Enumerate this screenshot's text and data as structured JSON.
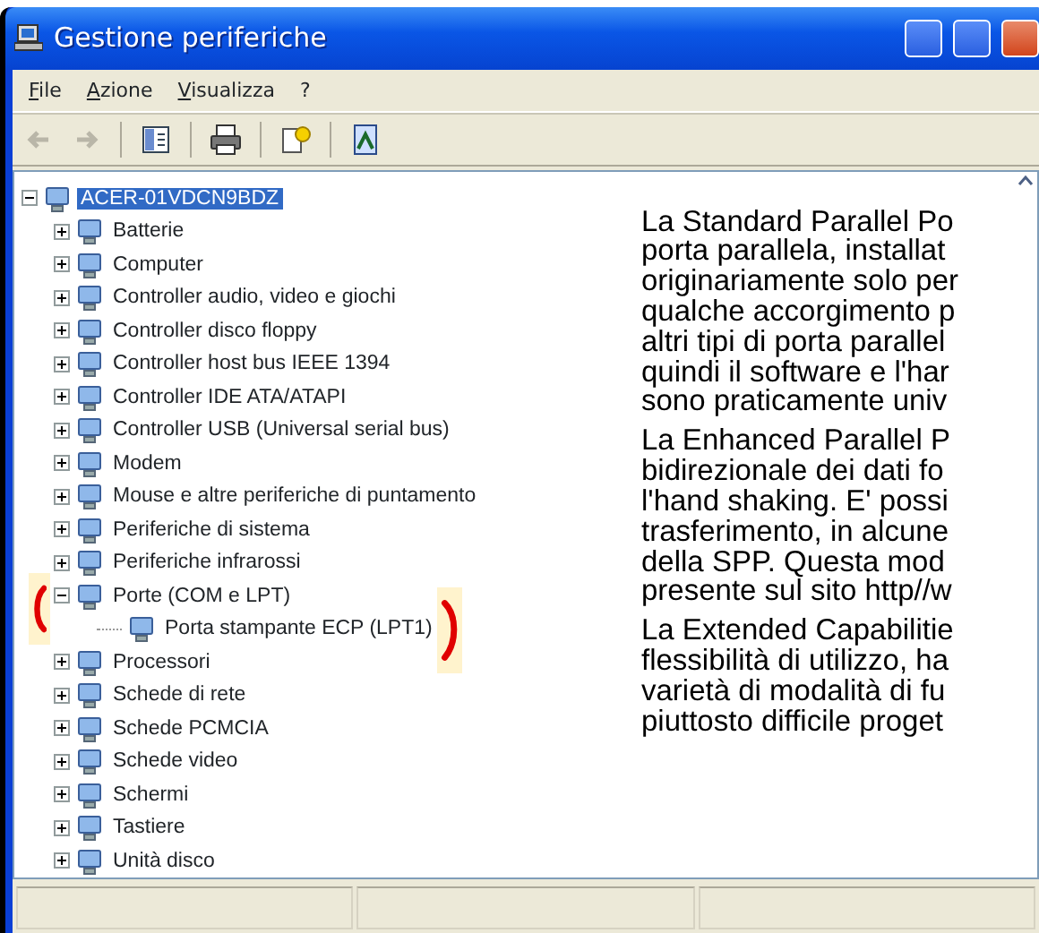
{
  "window": {
    "title": "Gestione periferiche"
  },
  "menu": [
    "File",
    "Azione",
    "Visualizza",
    "?"
  ],
  "navigation": [
    {
      "disabled": true
    },
    {
      "disabled": true
    }
  ],
  "tree": {
    "label": "ACER-01VDCN9BDZ",
    "selected": true,
    "expanded": true,
    "children": [
      {
        "label": "Batterie",
        "expanded": false,
        "selected": false
      },
      {
        "label": "Computer",
        "expanded": false,
        "selected": false
      },
      {
        "label": "Controller audio, video e giochi",
        "expanded": false,
        "selected": false
      },
      {
        "label": "Controller disco floppy",
        "expanded": false,
        "selected": false
      },
      {
        "label": "Controller host bus IEEE 1394",
        "expanded": false,
        "selected": false
      },
      {
        "label": "Controller IDE ATA/ATAPI",
        "expanded": false,
        "selected": false
      },
      {
        "label": "Controller USB (Universal serial bus)",
        "expanded": false,
        "selected": false
      },
      {
        "label": "Modem",
        "expanded": false,
        "selected": false
      },
      {
        "label": "Mouse e altre periferiche di puntamento",
        "expanded": false,
        "selected": false
      },
      {
        "label": "Periferiche di sistema",
        "expanded": false,
        "selected": false
      },
      {
        "label": "Periferiche infrarossi",
        "expanded": false,
        "selected": false
      },
      {
        "label": "Porte (COM e LPT)",
        "expanded": true,
        "selected": false,
        "children": [
          {
            "label": "Porta stampante ECP (LPT1)",
            "selected": false
          }
        ]
      },
      {
        "label": "Processori",
        "expanded": false,
        "selected": false
      },
      {
        "label": "Schede di rete",
        "expanded": false,
        "selected": false
      },
      {
        "label": "Schede PCMCIA",
        "expanded": false,
        "selected": false
      },
      {
        "label": "Schede video",
        "expanded": false,
        "selected": false
      },
      {
        "label": "Schermi",
        "expanded": false,
        "selected": false
      },
      {
        "label": "Tastiere",
        "expanded": false,
        "selected": false
      },
      {
        "label": "Unità disco",
        "expanded": false,
        "selected": false
      }
    ]
  },
  "overlay_text": [
    {
      "lines": [
        "La Standard Parallel Po",
        "porta parallela, installat",
        "originariamente solo per",
        "qualche accorgimento p",
        "altri tipi di porta parallel",
        "quindi il software e l'har",
        "sono praticamente univ"
      ]
    },
    {
      "lines": [
        "La Enhanced Parallel P",
        "bidirezionale dei dati fo",
        "l'hand shaking. E' possi",
        "trasferimento, in alcune",
        "della SPP. Questa mod",
        "presente sul sito http//w"
      ]
    },
    {
      "lines": [
        "La Extended Capabilitie",
        "flessibilità di utilizzo, ha",
        "varietà di modalità di fu",
        "piuttosto difficile proget"
      ]
    }
  ]
}
